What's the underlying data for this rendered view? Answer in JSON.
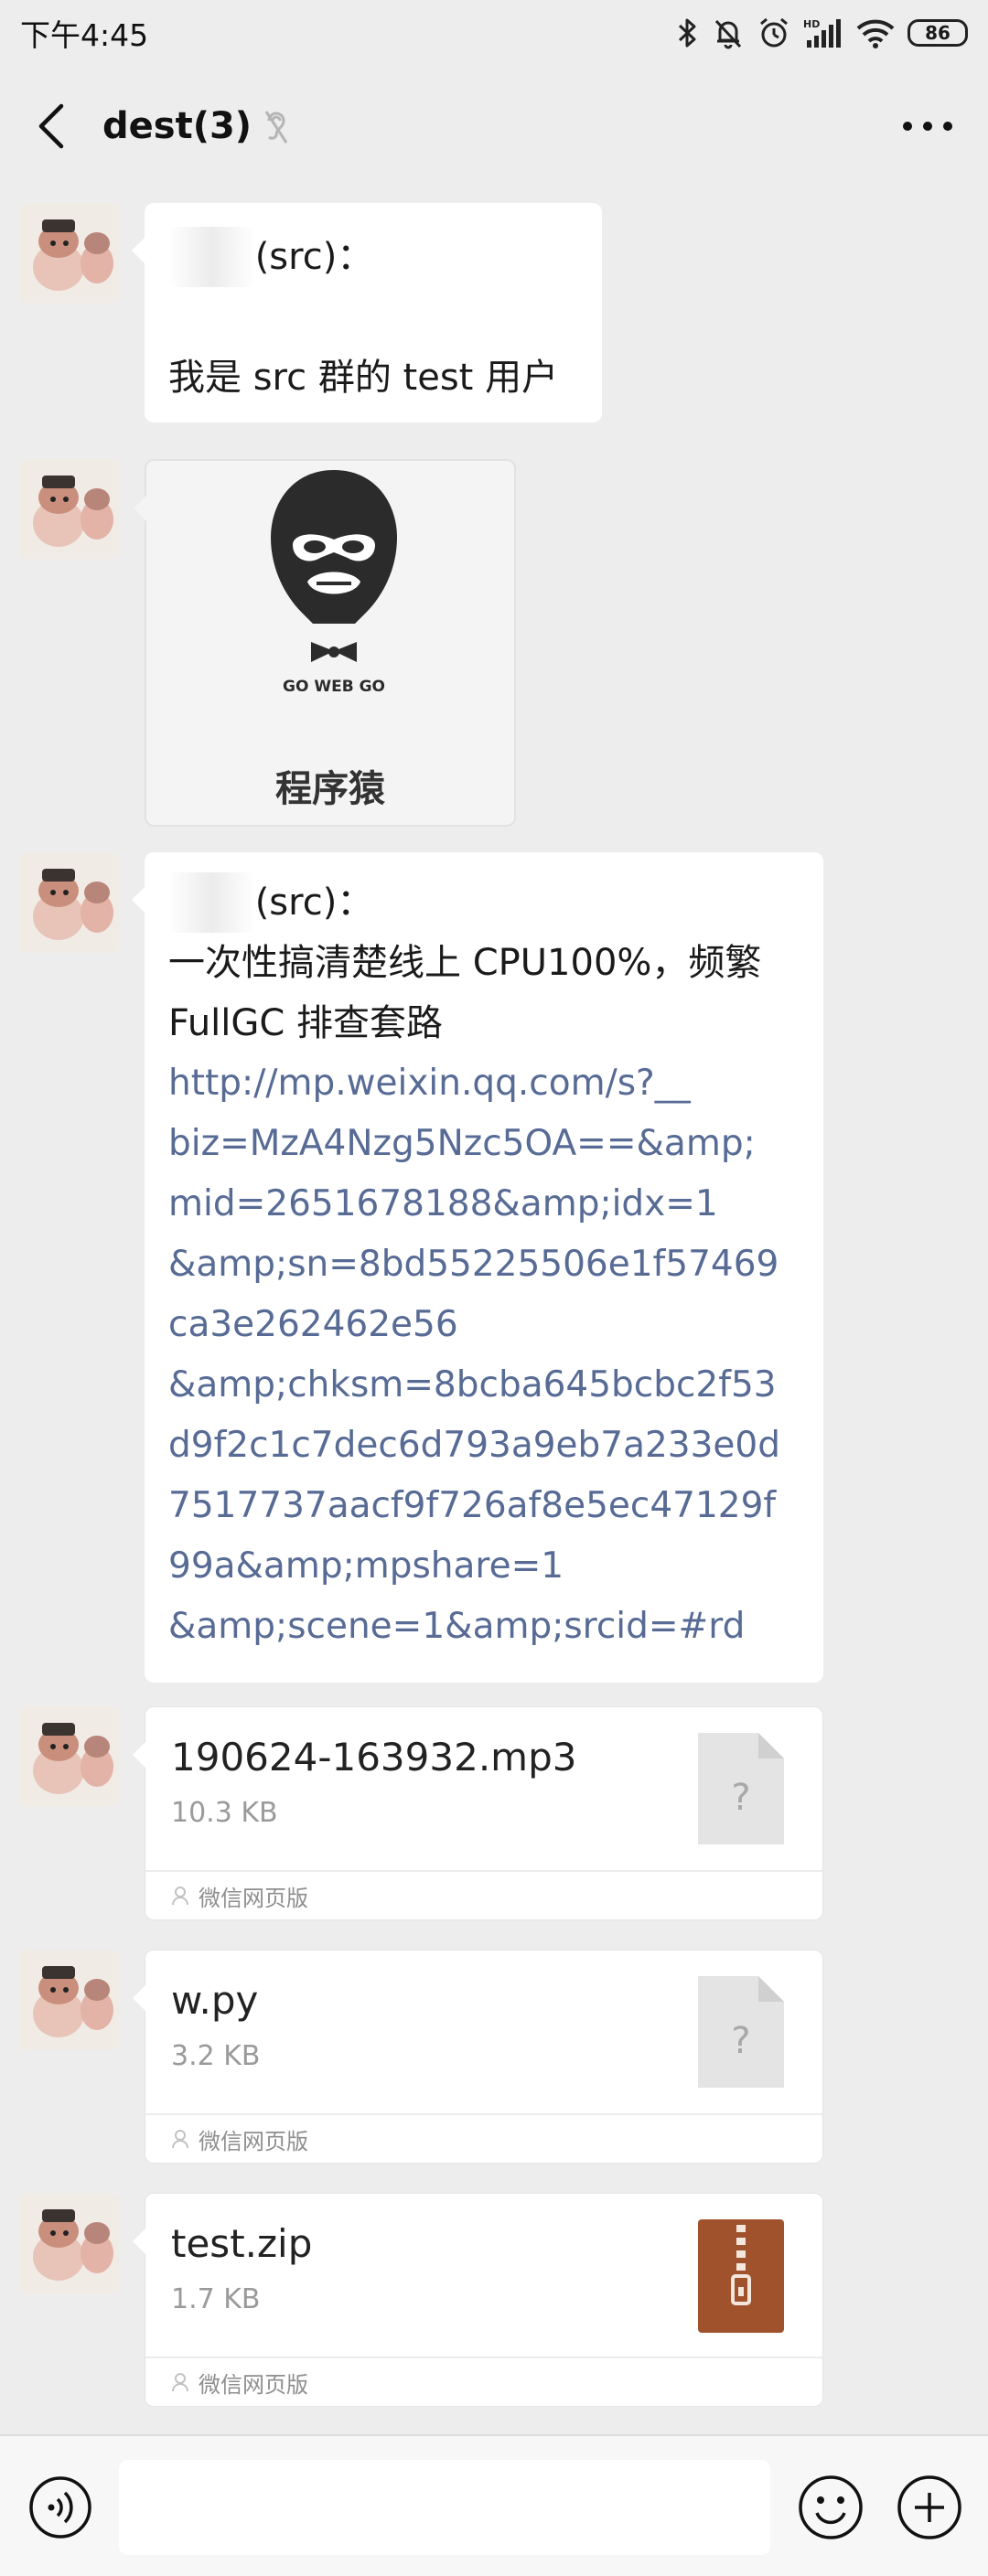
{
  "status_bar": {
    "time": "下午4:45",
    "battery": "86",
    "icons": [
      "bluetooth-icon",
      "mute-bell-icon",
      "alarm-icon",
      "hd-signal-icon",
      "wifi-icon",
      "battery-icon"
    ]
  },
  "header": {
    "title": "dest(3)",
    "icons": [
      "back-arrow-icon",
      "mute-ear-icon",
      "more-dots-icon"
    ]
  },
  "messages": [
    {
      "type": "text",
      "sender": "(src)：",
      "text": "我是 src 群的 test 用户"
    },
    {
      "type": "sticker",
      "logo_text": "GO WEB GO",
      "caption": "程序猿"
    },
    {
      "type": "link_text",
      "sender": "(src)：",
      "title": "一次性搞清楚线上 CPU100%，频繁 FullGC 排查套路",
      "link_lines": [
        "http://mp.weixin.qq.com/s?__",
        "biz=MzA4Nzg5Nzc5OA==&amp;",
        "mid=2651678188&amp;idx=1",
        "&amp;sn=8bd55225506e1f57469",
        "ca3e262462e56",
        "&amp;chksm=8bcba645bcbc2f53",
        "d9f2c1c7dec6d793a9eb7a233e0d",
        "7517737aacf9f726af8e5ec47129f",
        "99a&amp;mpshare=1",
        "&amp;scene=1&amp;srcid=#rd"
      ]
    },
    {
      "type": "file",
      "name": "190624-163932.mp3",
      "size": "10.3 KB",
      "source": "微信网页版",
      "file_icon": "unknown-file-icon",
      "icon_glyph": "?"
    },
    {
      "type": "file",
      "name": "w.py",
      "size": "3.2 KB",
      "source": "微信网页版",
      "file_icon": "unknown-file-icon",
      "icon_glyph": "?"
    },
    {
      "type": "file",
      "name": "test.zip",
      "size": "1.7 KB",
      "source": "微信网页版",
      "file_icon": "zip-file-icon"
    }
  ],
  "input_bar": {
    "placeholder": "",
    "icons": [
      "voice-icon",
      "emoji-icon",
      "plus-icon"
    ]
  },
  "colors": {
    "background": "#ededed",
    "bubble": "#ffffff",
    "link": "#576b95",
    "meta_text": "#9a9a9a",
    "zip_icon": "#a0522d"
  }
}
